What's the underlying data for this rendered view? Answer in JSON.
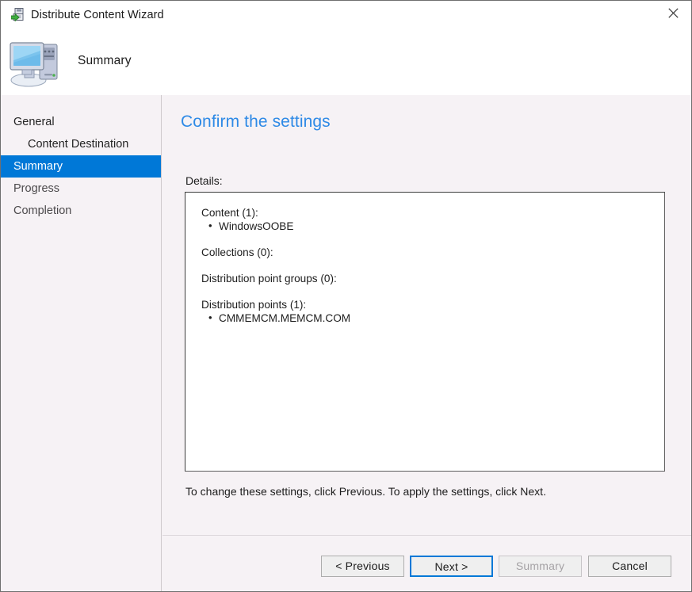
{
  "window": {
    "title": "Distribute Content Wizard",
    "title_icon": "distribute-content-icon",
    "close_label": "Close"
  },
  "header": {
    "title": "Summary",
    "icon": "computer-monitor-icon"
  },
  "sidebar": {
    "items": [
      {
        "label": "General",
        "selected": false,
        "indented": false
      },
      {
        "label": "Content Destination",
        "selected": false,
        "indented": true
      },
      {
        "label": "Summary",
        "selected": true,
        "indented": false
      },
      {
        "label": "Progress",
        "selected": false,
        "indented": false
      },
      {
        "label": "Completion",
        "selected": false,
        "indented": false
      }
    ],
    "selected_color": "#0078d7"
  },
  "main": {
    "heading": "Confirm the settings",
    "heading_color": "#2e8ae6",
    "details_label": "Details:",
    "details": [
      {
        "heading": "Content (1):",
        "items": [
          "WindowsOOBE"
        ]
      },
      {
        "heading": "Collections (0):",
        "items": []
      },
      {
        "heading": "Distribution point groups (0):",
        "items": []
      },
      {
        "heading": "Distribution points (1):",
        "items": [
          "CMMEMCM.MEMCM.COM"
        ]
      }
    ],
    "footnote": "To change these settings, click Previous. To apply the settings, click Next."
  },
  "buttons": {
    "previous": "< Previous",
    "next": "Next >",
    "summary": "Summary",
    "cancel": "Cancel"
  }
}
